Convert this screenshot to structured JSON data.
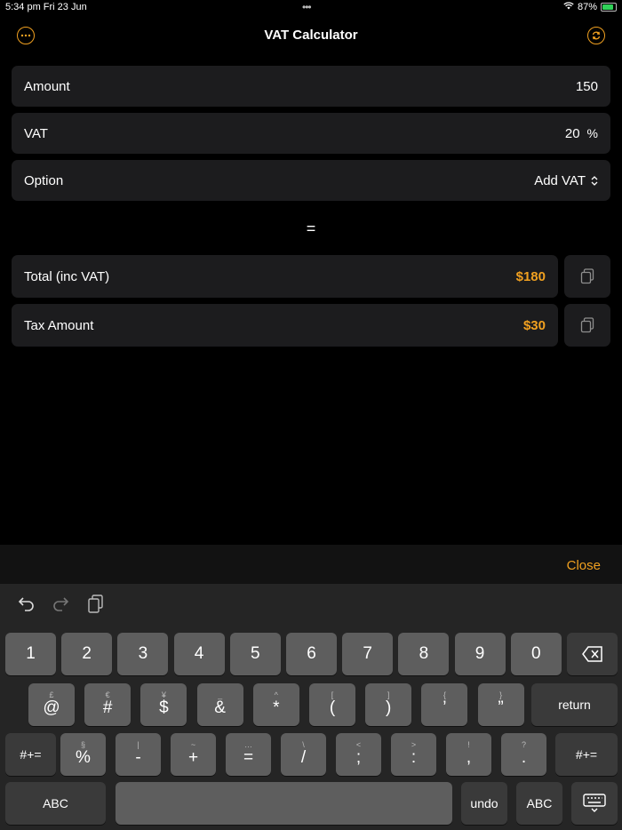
{
  "status_bar": {
    "time_date": "5:34 pm   Fri 23 Jun",
    "dots": "•••",
    "battery": "87%"
  },
  "nav": {
    "title": "VAT Calculator"
  },
  "inputs": {
    "amount": {
      "label": "Amount",
      "value": "150"
    },
    "vat": {
      "label": "VAT",
      "value": "20",
      "unit": "%"
    },
    "option": {
      "label": "Option",
      "value": "Add VAT"
    }
  },
  "equals": "=",
  "results": {
    "total": {
      "label": "Total (inc VAT)",
      "value": "$180"
    },
    "tax": {
      "label": "Tax Amount",
      "value": "$30"
    }
  },
  "accessory": {
    "close": "Close"
  },
  "keyboard": {
    "row1": [
      "1",
      "2",
      "3",
      "4",
      "5",
      "6",
      "7",
      "8",
      "9",
      "0"
    ],
    "row2": [
      {
        "main": "@",
        "alt": "£"
      },
      {
        "main": "#",
        "alt": "€"
      },
      {
        "main": "$",
        "alt": "¥"
      },
      {
        "main": "&",
        "alt": "_"
      },
      {
        "main": "*",
        "alt": "^"
      },
      {
        "main": "(",
        "alt": "["
      },
      {
        "main": ")",
        "alt": "]"
      },
      {
        "main": "’",
        "alt": "{"
      },
      {
        "main": "”",
        "alt": "}"
      }
    ],
    "return": "return",
    "row3_left": "#+=",
    "row3": [
      {
        "main": "%",
        "alt": "§"
      },
      {
        "main": "-",
        "alt": "|"
      },
      {
        "main": "+",
        "alt": "~"
      },
      {
        "main": "=",
        "alt": "…"
      },
      {
        "main": "/",
        "alt": "\\"
      },
      {
        "main": ";",
        "alt": "<"
      },
      {
        "main": ":",
        "alt": ">"
      },
      {
        "main": ",",
        "alt": "!"
      },
      {
        "main": ".",
        "alt": "?"
      }
    ],
    "row3_right": "#+=",
    "abc_left": "ABC",
    "undo": "undo",
    "abc_right": "ABC"
  },
  "colors": {
    "accent": "#f0a020",
    "panel": "#1c1c1e",
    "key": "#5e5e5e",
    "key_dark": "#3a3a3a"
  }
}
